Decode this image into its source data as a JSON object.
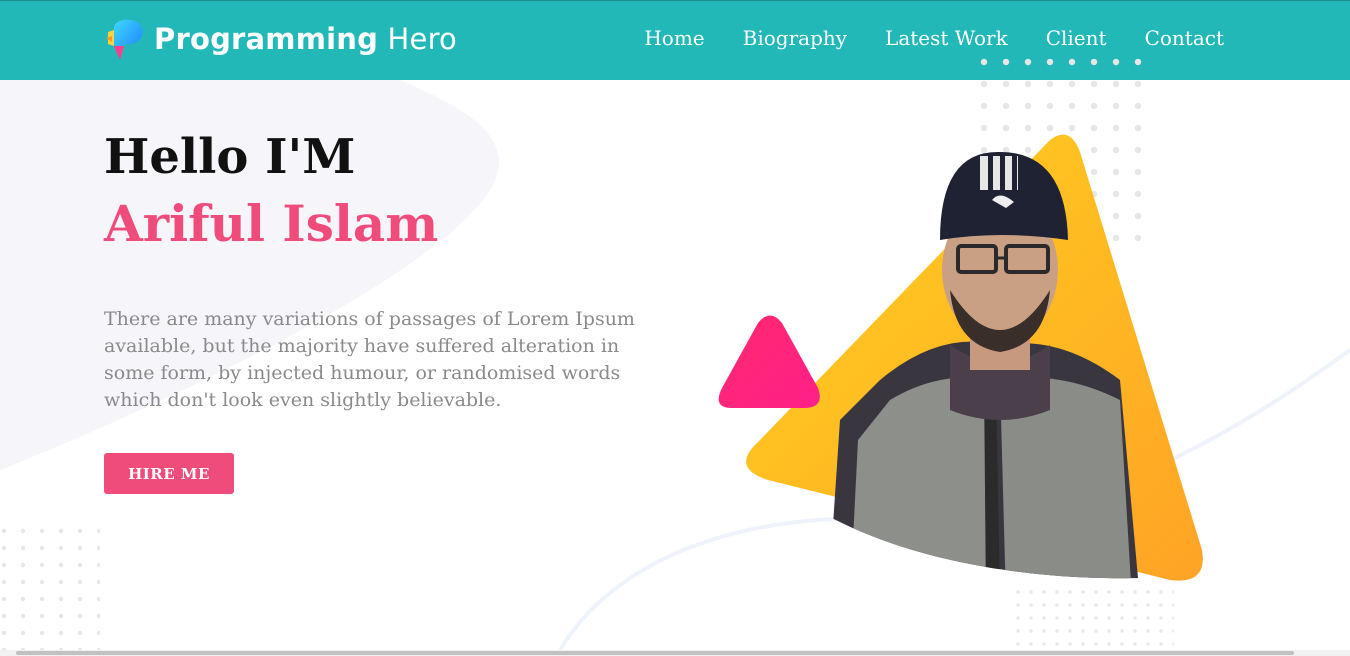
{
  "brand": {
    "name_bold": "Programming",
    "name_light": "Hero",
    "logo_icon": "brand-logo-icon"
  },
  "nav": {
    "items": [
      {
        "label": "Home"
      },
      {
        "label": "Biography"
      },
      {
        "label": "Latest Work"
      },
      {
        "label": "Client"
      },
      {
        "label": "Contact"
      }
    ]
  },
  "hero": {
    "greeting": "Hello I'M",
    "name": "Ariful Islam",
    "description": "There are many variations of passages of Lorem Ipsum available, but the majority have suffered alteration in some form, by injected humour, or randomised words which don't look even slightly believable.",
    "cta_label": "HIRE ME"
  },
  "colors": {
    "navbar": "#22b8b8",
    "accent": "#ef4b7b",
    "triangle_yellow": "#ffc21f",
    "triangle_pink": "#ff1f74"
  },
  "portrait": {
    "icon": "person-portrait"
  }
}
